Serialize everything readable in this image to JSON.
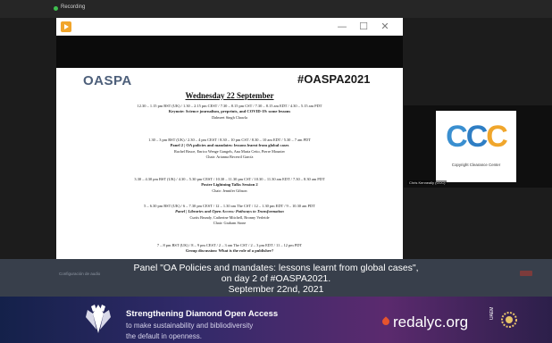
{
  "recording": {
    "label": "Recording"
  },
  "window": {
    "minimize": "—",
    "maximize": "☐",
    "close": "✕"
  },
  "slide": {
    "logo": "OASPA",
    "hashtag": "#OASPA2021",
    "day_heading": "Wednesday 22 September",
    "sessions": [
      {
        "time": "12.30 – 1.15 pm BST (UK) / 1.30 – 2.15 pm CEST / 7.30 – 8.15 pm CST / 7.30 – 8.15 am EDT / 4.30 – 5.15 am PDT",
        "title": "Keynote: Science journalism, preprints, and COVID-19: some lessons",
        "names": "Dalmeet Singh Chawla",
        "chair": ""
      },
      {
        "time": "1.30 – 3 pm BST (UK) / 2.30 – 4 pm CEST / 8.30 – 10 pm CST / 8.30 – 10 am EDT / 5.30 – 7 am PDT",
        "title": "Panel 2 | OA policies and mandates: lessons learnt from global cases",
        "names": "Rachel Bruce, Enrico Wenge Gangels, Ana Maria Cetto, Pierre Mounier",
        "chair": "Chair: Arianna Becerril García"
      },
      {
        "time": "3.30 – 4.30 pm BST (UK) / 4.30 – 5.30 pm CEST / 10.30 – 11.30 pm CST / 10.30 – 11.30 am EDT / 7.30 – 8.30 am PDT",
        "title": "Poster Lightning Talks Session 2",
        "names": "",
        "chair": "Chair: Jennifer Gibson"
      },
      {
        "time": "5 – 6.30 pm BST (UK) / 6 – 7.30 pm CEST / 12 – 1.30 am The CST / 12 – 1.30 pm EDT / 9 – 10.30 am PDT",
        "title": "Panel | Libraries and Open Access: Pathways to Transformation",
        "names": "Curtis Brundy, Catherine Mitchell, Bronny Verleide",
        "chair": "Chair: Graham Stone"
      },
      {
        "time": "7 – 8 pm BST (UK) / 8 – 9 pm CEST / 2 – 3 am The CST / 2 – 3 pm EDT / 11 – 12 pm PDT",
        "title": "Group discussion: What is the role of a publisher?",
        "names": "",
        "chair": ""
      }
    ]
  },
  "speaker_tile": {
    "logo_letters": [
      "C",
      "C",
      "C"
    ],
    "logo_subtitle": "Copyright Clearance Center",
    "participant_name": "Chris Kenneally (CCC)"
  },
  "caption": {
    "line1": "Panel \"OA Policies and mandates: lessons learnt from global cases\",",
    "line2": "on day 2 of #OASPA2021.",
    "line3": "September 22nd, 2021"
  },
  "caption_bar": {
    "left_text": "Configuración de audio"
  },
  "banner": {
    "title": "Strengthening Diamond Open Access",
    "subtitle1": "to make sustainability and bibliodiversity",
    "subtitle2": "the default in openness.",
    "brand": "redalyc.org",
    "brand_tag": "UAEM"
  },
  "colors": {
    "brand_blue": "#3a8fd0",
    "brand_orange": "#f0a62c",
    "banner_start": "#14214a",
    "banner_end": "#5b2a6e",
    "redalyc_accent": "#e6542e"
  }
}
